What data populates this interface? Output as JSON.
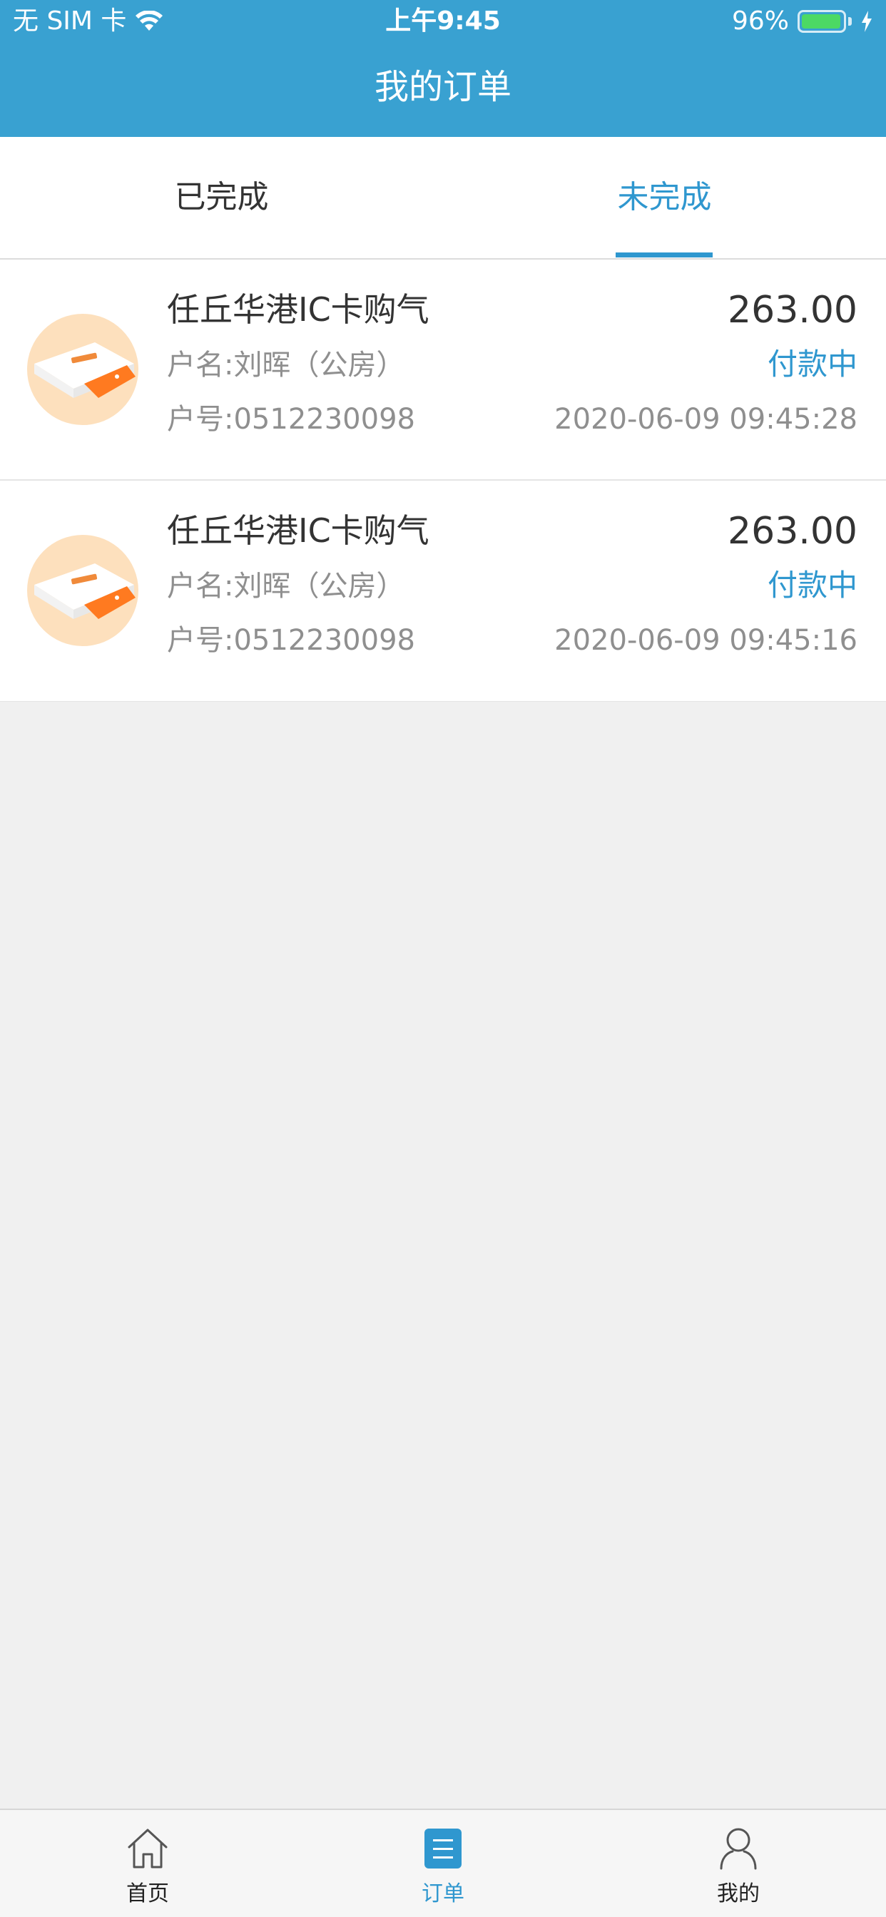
{
  "status_bar": {
    "carrier": "无 SIM 卡",
    "time": "上午9:45",
    "battery_percent": "96%",
    "battery_level": 0.96
  },
  "header": {
    "title": "我的订单"
  },
  "tabs": [
    {
      "label": "已完成",
      "active": false
    },
    {
      "label": "未完成",
      "active": true
    }
  ],
  "orders": [
    {
      "title": "任丘华港IC卡购气",
      "owner": "户名:刘晖（公房）",
      "account": "户号:0512230098",
      "amount": "263.00",
      "status": "付款中",
      "time": "2020-06-09 09:45:28",
      "icon": "ic-card-reader-icon"
    },
    {
      "title": "任丘华港IC卡购气",
      "owner": "户名:刘晖（公房）",
      "account": "户号:0512230098",
      "amount": "263.00",
      "status": "付款中",
      "time": "2020-06-09 09:45:16",
      "icon": "ic-card-reader-icon"
    }
  ],
  "bottom_nav": [
    {
      "label": "首页",
      "icon": "home-icon",
      "active": false
    },
    {
      "label": "订单",
      "icon": "orders-icon",
      "active": true
    },
    {
      "label": "我的",
      "icon": "profile-icon",
      "active": false
    }
  ],
  "colors": {
    "header_bg": "#39a1d1",
    "accent": "#2f97cf",
    "page_bg": "#f0f0f0",
    "battery_green": "#4cd964"
  }
}
